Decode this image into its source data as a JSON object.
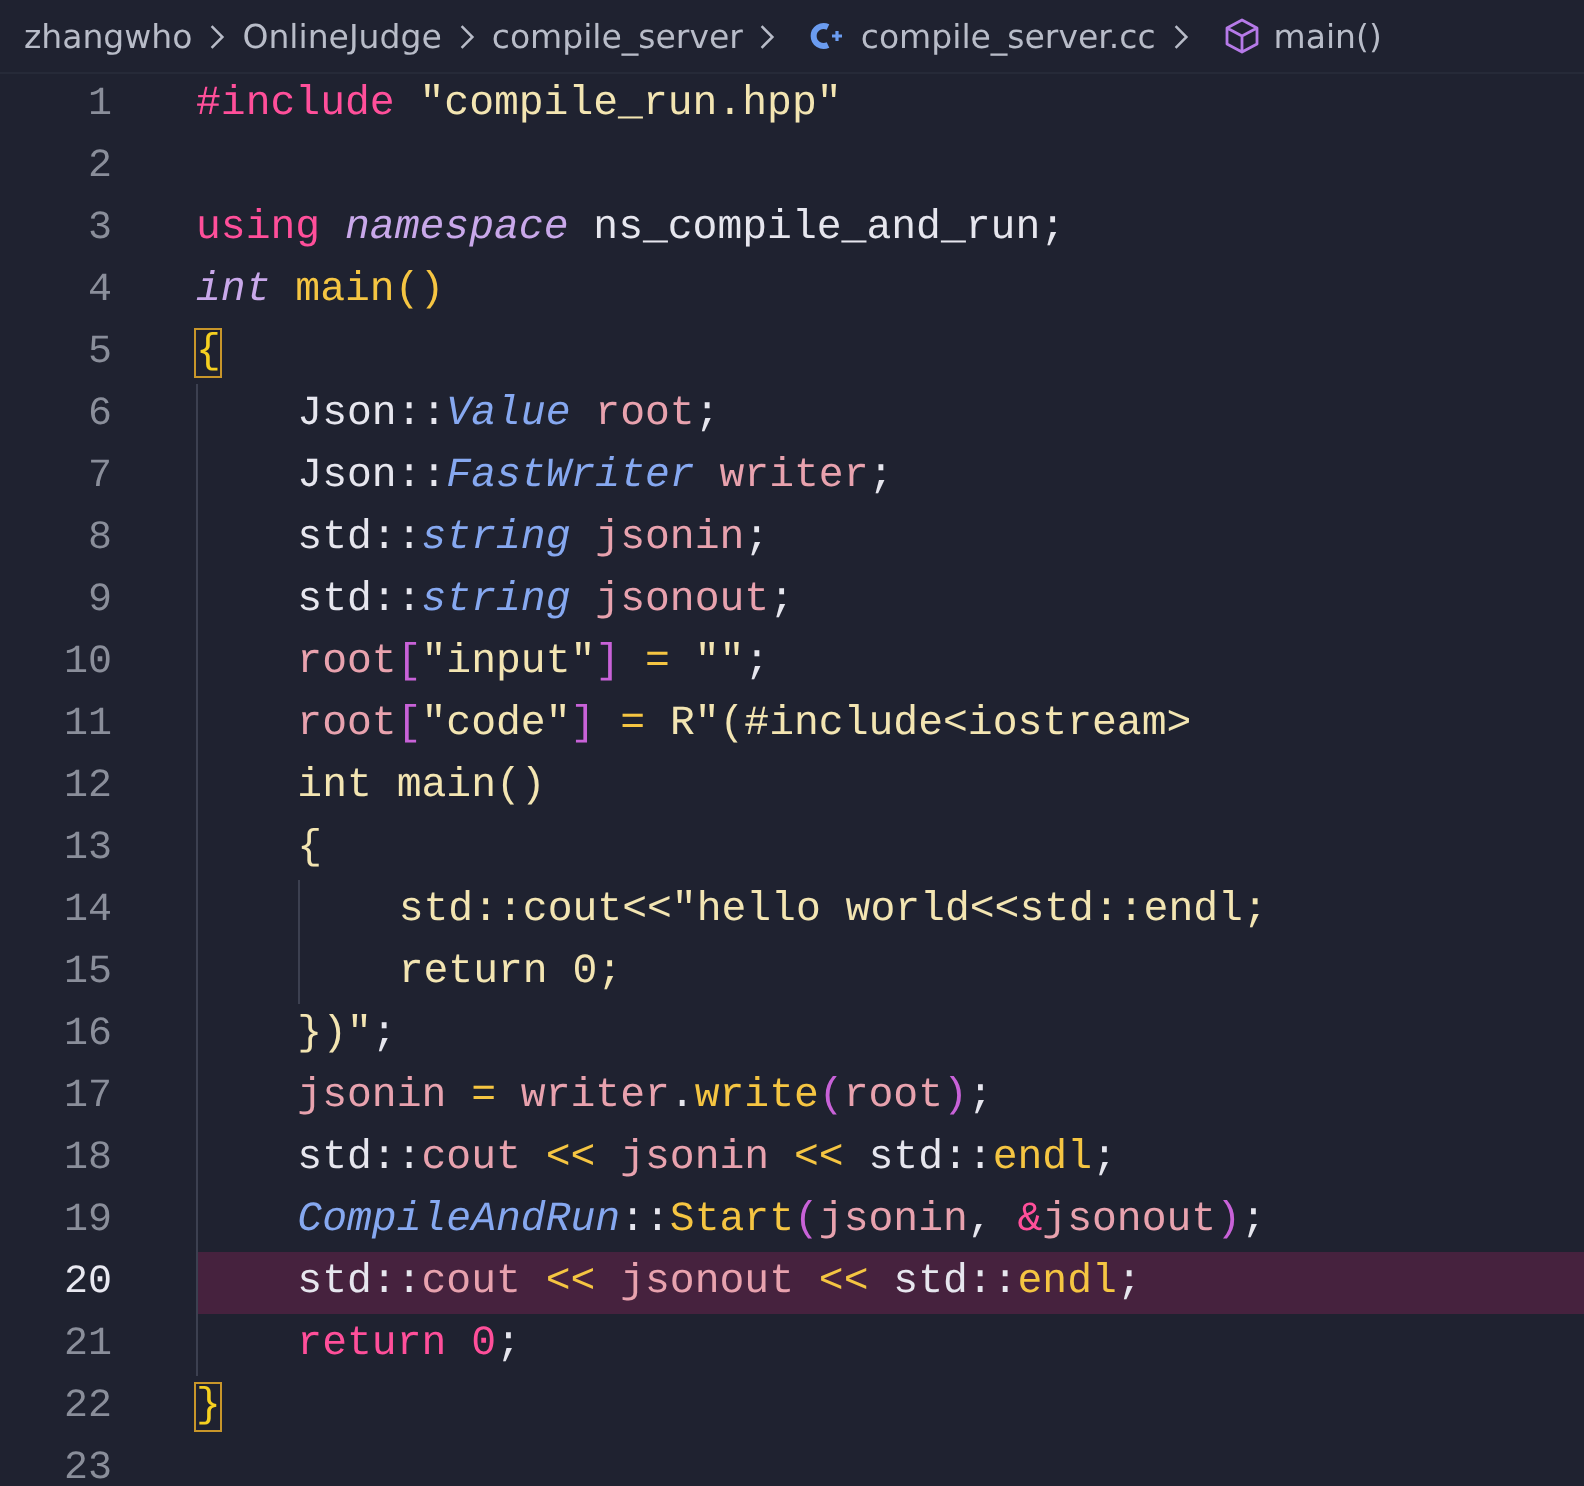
{
  "breadcrumb": [
    {
      "kind": "folder",
      "label": "zhangwho"
    },
    {
      "kind": "folder",
      "label": "OnlineJudge"
    },
    {
      "kind": "folder",
      "label": "compile_server"
    },
    {
      "kind": "file",
      "label": "compile_server.cc"
    },
    {
      "kind": "symbol",
      "label": "main()"
    }
  ],
  "lines": [
    {
      "number": "1",
      "selected": false,
      "tokens": [
        {
          "kind": "keyword",
          "text": "#include "
        },
        {
          "kind": "string",
          "text": "\"compile_run.hpp\""
        }
      ]
    },
    {
      "number": "2",
      "selected": false
    },
    {
      "number": "3",
      "selected": false,
      "tokens": [
        {
          "kind": "keyword",
          "text": "using "
        },
        {
          "kind": "storage",
          "text": "namespace"
        },
        {
          "kind": "plain",
          "text": " ns_compile_and_run;"
        }
      ]
    },
    {
      "number": "4",
      "selected": false,
      "tokens": [
        {
          "kind": "storage",
          "text": "int"
        },
        {
          "kind": "function",
          "text": " main"
        },
        {
          "kind": "paren",
          "text": "()"
        }
      ]
    },
    {
      "number": "5",
      "selected": false,
      "tokens": [
        {
          "kind": "match",
          "text": "{"
        }
      ]
    },
    {
      "number": "6",
      "selected": false,
      "tokens": [
        {
          "kind": "plain",
          "text": "    Json::"
        },
        {
          "kind": "type",
          "text": "Value"
        },
        {
          "kind": "variable",
          "text": " root"
        },
        {
          "kind": "plain",
          "text": ";"
        }
      ]
    },
    {
      "number": "7",
      "selected": false,
      "tokens": [
        {
          "kind": "plain",
          "text": "    Json::"
        },
        {
          "kind": "type",
          "text": "FastWriter"
        },
        {
          "kind": "variable",
          "text": " writer"
        },
        {
          "kind": "plain",
          "text": ";"
        }
      ]
    },
    {
      "number": "8",
      "selected": false,
      "tokens": [
        {
          "kind": "plain",
          "text": "    std::"
        },
        {
          "kind": "type",
          "text": "string"
        },
        {
          "kind": "variable",
          "text": " jsonin"
        },
        {
          "kind": "plain",
          "text": ";"
        }
      ]
    },
    {
      "number": "9",
      "selected": false,
      "tokens": [
        {
          "kind": "plain",
          "text": "    std::"
        },
        {
          "kind": "type",
          "text": "string"
        },
        {
          "kind": "variable",
          "text": " jsonout"
        },
        {
          "kind": "plain",
          "text": ";"
        }
      ]
    },
    {
      "number": "10",
      "selected": false,
      "tokens": [
        {
          "kind": "variable",
          "text": "    root"
        },
        {
          "kind": "bracket",
          "text": "["
        },
        {
          "kind": "string",
          "text": "\"input\""
        },
        {
          "kind": "bracket",
          "text": "]"
        },
        {
          "kind": "operator",
          "text": " = "
        },
        {
          "kind": "string",
          "text": "\"\""
        },
        {
          "kind": "plain",
          "text": ";"
        }
      ]
    },
    {
      "number": "11",
      "selected": false,
      "tokens": [
        {
          "kind": "variable",
          "text": "    root"
        },
        {
          "kind": "bracket",
          "text": "["
        },
        {
          "kind": "string",
          "text": "\"code\""
        },
        {
          "kind": "bracket",
          "text": "]"
        },
        {
          "kind": "operator",
          "text": " = "
        },
        {
          "kind": "string",
          "text": "R\"(#include<iostream>"
        }
      ]
    },
    {
      "number": "12",
      "selected": false,
      "tokens": [
        {
          "kind": "string",
          "text": "    int main()"
        }
      ]
    },
    {
      "number": "13",
      "selected": false,
      "tokens": [
        {
          "kind": "string",
          "text": "    {"
        }
      ]
    },
    {
      "number": "14",
      "selected": false,
      "tokens": [
        {
          "kind": "string",
          "text": "        std::cout<<\"hello world<<std::endl;"
        }
      ]
    },
    {
      "number": "15",
      "selected": false,
      "tokens": [
        {
          "kind": "string",
          "text": "        return 0;"
        }
      ]
    },
    {
      "number": "16",
      "selected": false,
      "tokens": [
        {
          "kind": "string",
          "text": "    })\""
        },
        {
          "kind": "plain",
          "text": ";"
        }
      ]
    },
    {
      "number": "17",
      "selected": false,
      "tokens": [
        {
          "kind": "variable",
          "text": "    jsonin"
        },
        {
          "kind": "operator",
          "text": " = "
        },
        {
          "kind": "variable",
          "text": "writer"
        },
        {
          "kind": "plain",
          "text": "."
        },
        {
          "kind": "function",
          "text": "write"
        },
        {
          "kind": "bracket",
          "text": "("
        },
        {
          "kind": "variable",
          "text": "root"
        },
        {
          "kind": "bracket",
          "text": ")"
        },
        {
          "kind": "plain",
          "text": ";"
        }
      ]
    },
    {
      "number": "18",
      "selected": false,
      "tokens": [
        {
          "kind": "plain",
          "text": "    std::"
        },
        {
          "kind": "variable",
          "text": "cout"
        },
        {
          "kind": "operator",
          "text": " << "
        },
        {
          "kind": "variable",
          "text": "jsonin"
        },
        {
          "kind": "operator",
          "text": " << "
        },
        {
          "kind": "plain",
          "text": "std::"
        },
        {
          "kind": "function",
          "text": "endl"
        },
        {
          "kind": "plain",
          "text": ";"
        }
      ]
    },
    {
      "number": "19",
      "selected": false,
      "tokens": [
        {
          "kind": "type",
          "text": "    CompileAndRun"
        },
        {
          "kind": "plain",
          "text": "::"
        },
        {
          "kind": "function",
          "text": "Start"
        },
        {
          "kind": "bracket",
          "text": "("
        },
        {
          "kind": "variable",
          "text": "jsonin"
        },
        {
          "kind": "plain",
          "text": ", "
        },
        {
          "kind": "keyword",
          "text": "&"
        },
        {
          "kind": "variable",
          "text": "jsonout"
        },
        {
          "kind": "bracket",
          "text": ")"
        },
        {
          "kind": "plain",
          "text": ";"
        }
      ]
    },
    {
      "number": "20",
      "selected": true,
      "tokens": [
        {
          "kind": "plain",
          "text": "    std::"
        },
        {
          "kind": "variable",
          "text": "cout"
        },
        {
          "kind": "operator",
          "text": " << "
        },
        {
          "kind": "variable",
          "text": "jsonout"
        },
        {
          "kind": "operator",
          "text": " << "
        },
        {
          "kind": "plain",
          "text": "std::"
        },
        {
          "kind": "function",
          "text": "endl"
        },
        {
          "kind": "plain",
          "text": ";"
        }
      ]
    },
    {
      "number": "21",
      "selected": false,
      "tokens": [
        {
          "kind": "keyword",
          "text": "    return "
        },
        {
          "kind": "number",
          "text": "0"
        },
        {
          "kind": "plain",
          "text": ";"
        }
      ]
    },
    {
      "number": "22",
      "selected": false,
      "tokens": [
        {
          "kind": "match",
          "text": "}"
        }
      ]
    },
    {
      "number": "23",
      "selected": false
    }
  ]
}
